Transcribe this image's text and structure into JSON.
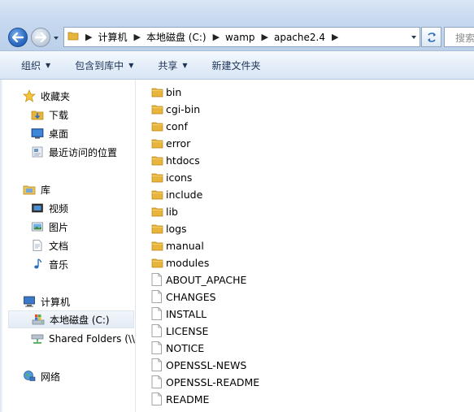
{
  "address_bar": {
    "breadcrumbs": [
      "计算机",
      "本地磁盘 (C:)",
      "wamp",
      "apache2.4"
    ],
    "search_placeholder": "搜索"
  },
  "toolbar": {
    "organize": "组织",
    "include_in_library": "包含到库中",
    "share": "共享",
    "new_folder": "新建文件夹"
  },
  "navigation": {
    "favorites": {
      "label": "收藏夹",
      "items": [
        "下载",
        "桌面",
        "最近访问的位置"
      ]
    },
    "libraries": {
      "label": "库",
      "items": [
        "视频",
        "图片",
        "文档",
        "音乐"
      ]
    },
    "computer": {
      "label": "计算机",
      "items": [
        "本地磁盘 (C:)",
        "Shared Folders (\\\\"
      ]
    },
    "network": {
      "label": "网络"
    }
  },
  "files": {
    "folders": [
      "bin",
      "cgi-bin",
      "conf",
      "error",
      "htdocs",
      "icons",
      "include",
      "lib",
      "logs",
      "manual",
      "modules"
    ],
    "documents": [
      "ABOUT_APACHE",
      "CHANGES",
      "INSTALL",
      "LICENSE",
      "NOTICE",
      "OPENSSL-NEWS",
      "OPENSSL-README",
      "README"
    ]
  },
  "colors": {
    "folder": "#e8b53c",
    "accent": "#1e3456",
    "frame": "#c6d8ef"
  }
}
